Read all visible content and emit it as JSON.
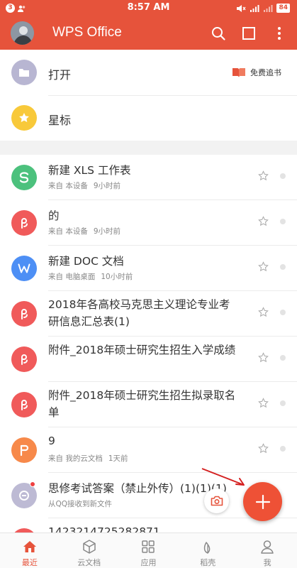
{
  "statusbar": {
    "notification_count": "3",
    "time": "8:57 AM",
    "battery": "84"
  },
  "appbar": {
    "title": "WPS Office"
  },
  "top_items": [
    {
      "label": "打开",
      "icon": "folder-icon",
      "color": "#b8b6d2"
    },
    {
      "label": "星标",
      "icon": "star-icon",
      "color": "#f8c93a"
    }
  ],
  "track": {
    "label": "免费追书"
  },
  "files": [
    {
      "title": "新建 XLS 工作表",
      "source": "来自 本设备",
      "time": "9小时前",
      "icon": "spreadsheet-icon",
      "color": "#4cc17d"
    },
    {
      "title": "的",
      "source": "来自 本设备",
      "time": "9小时前",
      "icon": "pdf-icon",
      "color": "#f05a5a"
    },
    {
      "title": "新建 DOC 文档",
      "source": "来自 电脑桌面",
      "time": "10小时前",
      "icon": "doc-icon",
      "color": "#4d8ff5"
    },
    {
      "title": "2018年各高校马克思主义理论专业考研信息汇总表(1)",
      "source": "",
      "time": "",
      "icon": "pdf-icon",
      "color": "#f05a5a"
    },
    {
      "title": "附件_2018年硕士研究生招生入学成绩",
      "source": "",
      "time": "",
      "icon": "pdf-icon",
      "color": "#f05a5a"
    },
    {
      "title": "附件_2018年硕士研究生招生拟录取名单",
      "source": "",
      "time": "",
      "icon": "pdf-icon",
      "color": "#f05a5a"
    },
    {
      "title": "9",
      "source": "来自 我的云文档",
      "time": "1天前",
      "icon": "ppt-icon",
      "color": "#f7894a"
    },
    {
      "title": "思修考试答案（禁止外传）(1)(1)(1)",
      "source": "从QQ接收到新文件",
      "time": "",
      "icon": "qq-file-icon",
      "color": "#bdbad4"
    },
    {
      "title": "1423214725282871",
      "source": "",
      "time": "",
      "icon": "pdf-icon",
      "color": "#f05a5a"
    }
  ],
  "nav": [
    {
      "label": "最近",
      "icon": "home-icon",
      "active": true
    },
    {
      "label": "云文档",
      "icon": "cloud-box-icon",
      "active": false
    },
    {
      "label": "应用",
      "icon": "apps-grid-icon",
      "active": false
    },
    {
      "label": "稻壳",
      "icon": "leaf-icon",
      "active": false
    },
    {
      "label": "我",
      "icon": "person-icon",
      "active": false
    }
  ],
  "colors": {
    "accent": "#e6533b",
    "fab": "#ee5136"
  }
}
